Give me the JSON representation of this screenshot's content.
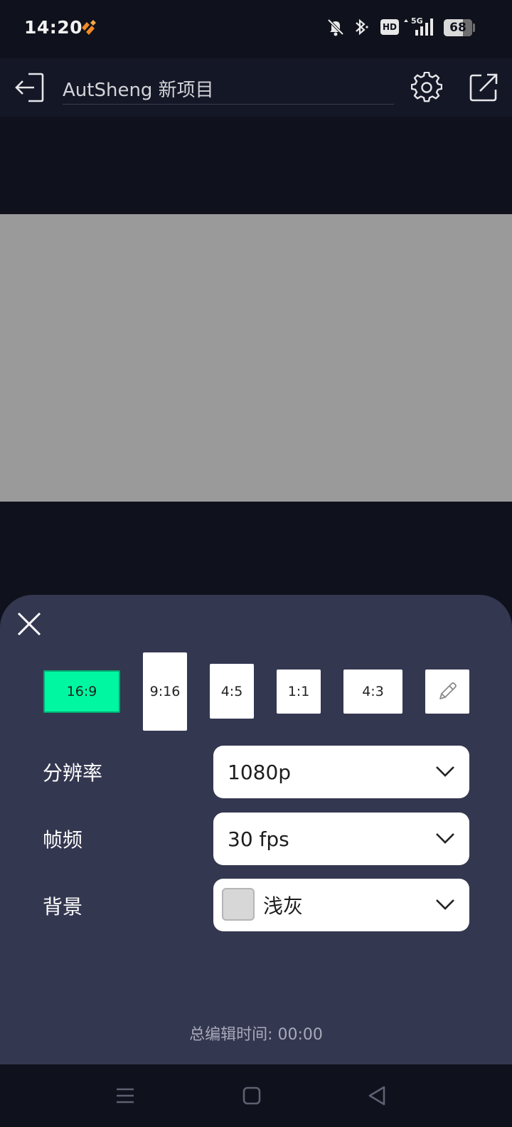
{
  "status_bar": {
    "time": "14:20",
    "hd_badge": "HD",
    "network": "5G",
    "battery_level": "68",
    "battery_fraction": 0.68,
    "icons": [
      "app-logo-icon",
      "bell-off-icon",
      "bluetooth-icon",
      "hd-icon",
      "signal-5g-icon",
      "battery-icon"
    ]
  },
  "top_bar": {
    "title": "AutSheng 新项目",
    "icons": [
      "exit-icon",
      "gear-icon",
      "share-icon"
    ]
  },
  "project_settings": {
    "aspect_ratios": [
      {
        "label": "16:9",
        "selected": true
      },
      {
        "label": "9:16",
        "selected": false
      },
      {
        "label": "4:5",
        "selected": false
      },
      {
        "label": "1:1",
        "selected": false
      },
      {
        "label": "4:3",
        "selected": false
      }
    ],
    "custom_ratio_icon": "pencil-icon",
    "resolution": {
      "label": "分辨率",
      "value": "1080p"
    },
    "frame_rate": {
      "label": "帧频",
      "value": "30 fps"
    },
    "background": {
      "label": "背景",
      "value": "浅灰",
      "swatch_color": "#d7d7d7"
    },
    "total_edit_time": "总编辑时间: 00:00"
  },
  "colors": {
    "app_background": "#0f111c",
    "sheet_background": "#343750",
    "accent": "#00f7a2",
    "preview_canvas": "#9a9a9a"
  },
  "nav_bar": {
    "icons": [
      "menu-icon",
      "home-icon",
      "back-icon"
    ]
  }
}
